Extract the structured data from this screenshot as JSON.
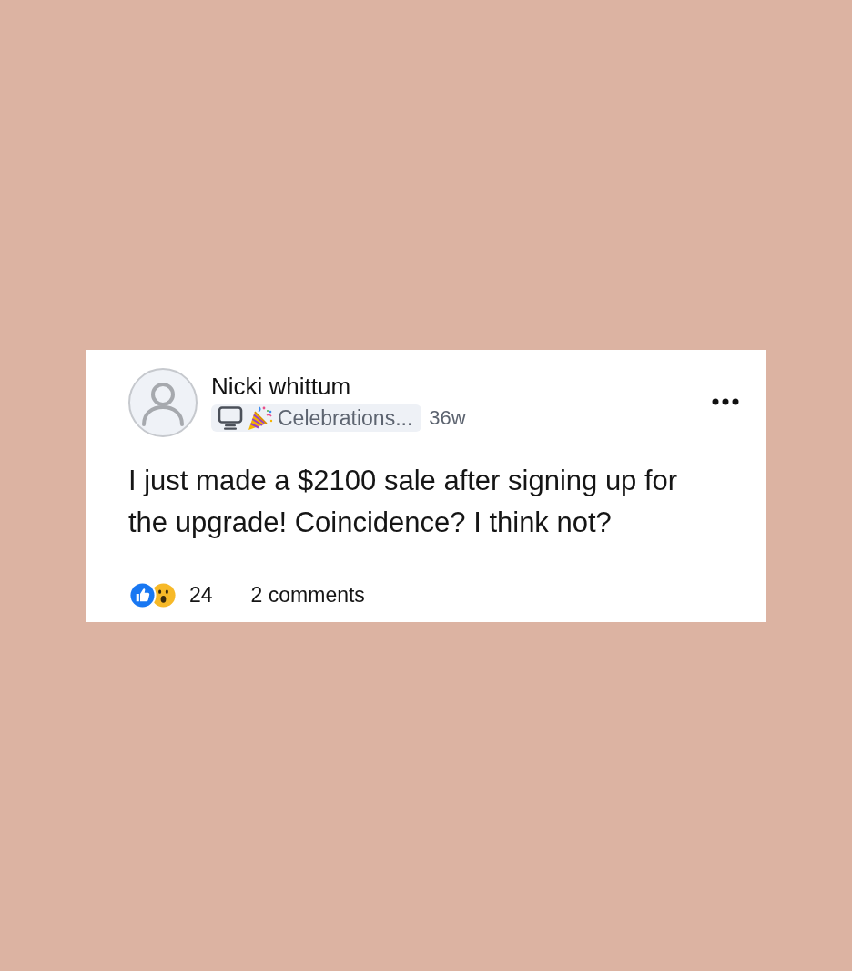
{
  "post": {
    "author": "Nicki whittum",
    "group": {
      "label": "Celebrations..."
    },
    "time": "36w",
    "body": "I just made a $2100 sale after signing up for the upgrade! Coincidence? I think not?",
    "reactions": [
      {
        "kind": "like"
      },
      {
        "kind": "wow"
      }
    ],
    "reaction_count": "24",
    "comments": "2 comments"
  }
}
